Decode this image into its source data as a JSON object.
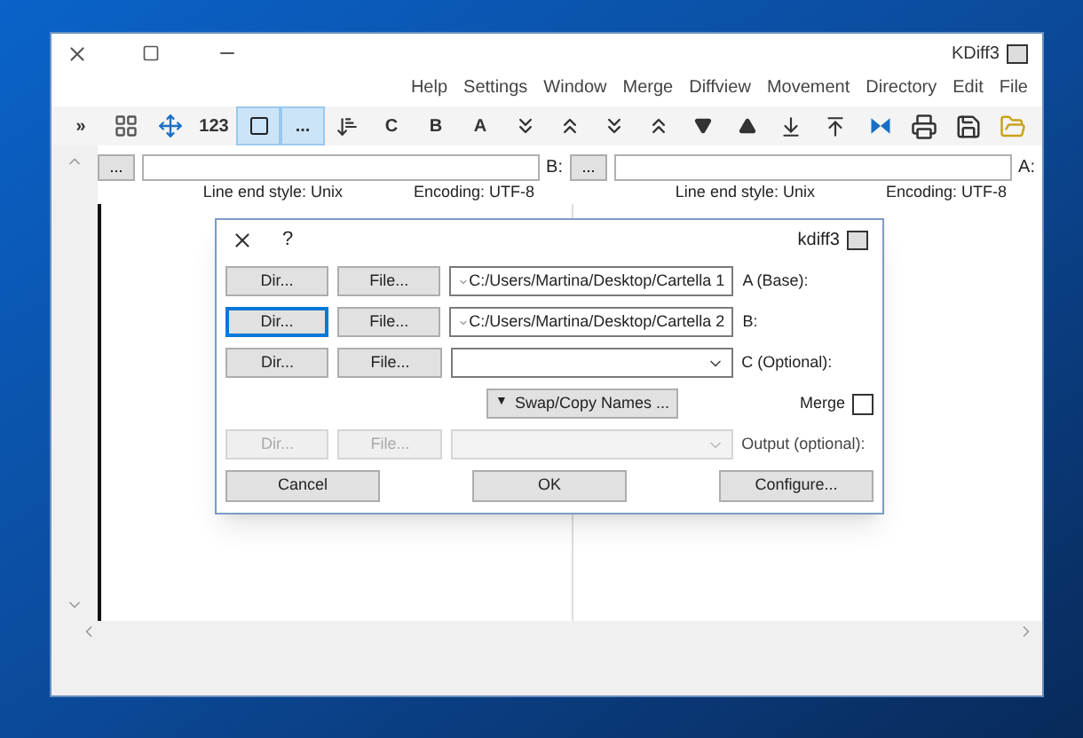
{
  "window": {
    "title": "KDiff3"
  },
  "menu": [
    "Help",
    "Settings",
    "Window",
    "Merge",
    "Diffview",
    "Movement",
    "Directory",
    "Edit",
    "File"
  ],
  "toolbar": [
    {
      "kind": "text",
      "label": "»",
      "selected": false
    },
    {
      "kind": "icon",
      "selected": false
    },
    {
      "kind": "icon",
      "selected": false
    },
    {
      "kind": "text",
      "label": "123",
      "selected": false
    },
    {
      "kind": "icon",
      "selected": true
    },
    {
      "kind": "text",
      "label": "...",
      "selected": true
    },
    {
      "kind": "icon",
      "selected": false
    },
    {
      "kind": "text",
      "label": "C",
      "selected": false
    },
    {
      "kind": "text",
      "label": "B",
      "selected": false
    },
    {
      "kind": "text",
      "label": "A",
      "selected": false
    },
    {
      "kind": "icon",
      "selected": false
    },
    {
      "kind": "icon",
      "selected": false
    },
    {
      "kind": "icon",
      "selected": false
    },
    {
      "kind": "icon",
      "selected": false
    },
    {
      "kind": "icon",
      "selected": false
    },
    {
      "kind": "icon",
      "selected": false
    },
    {
      "kind": "icon",
      "selected": false
    },
    {
      "kind": "icon",
      "selected": false
    },
    {
      "kind": "icon",
      "selected": false
    },
    {
      "kind": "icon",
      "selected": false
    },
    {
      "kind": "icon",
      "selected": false
    },
    {
      "kind": "icon",
      "selected": false
    }
  ],
  "panes": [
    {
      "label": "B:",
      "button": "...",
      "encoding": "Encoding: UTF-8",
      "line_end": "Line end style: Unix"
    },
    {
      "label": "A:",
      "button": "...",
      "encoding": "Encoding: UTF-8",
      "line_end": "Line end style: Unix"
    }
  ],
  "dialog": {
    "title": "kdiff3",
    "help": "?",
    "rows": [
      {
        "kind": "file",
        "label": "A (Base):",
        "value": "C:/Users/Martina/Desktop/Cartella 1",
        "file_button": "File...",
        "dir_button": "Dir...",
        "disabled": false,
        "focused": false
      },
      {
        "kind": "file",
        "label": "B:",
        "value": "C:/Users/Martina/Desktop/Cartella 2",
        "file_button": "File...",
        "dir_button": "Dir...",
        "disabled": false,
        "focused": true
      },
      {
        "kind": "file",
        "label": "C (Optional):",
        "file_button": "File...",
        "dir_button": "Dir...",
        "disabled": false,
        "focused": false
      },
      {
        "kind": "merge",
        "label": "Merge",
        "checked": false,
        "caret": "▼",
        "button": "Swap/Copy Names ..."
      },
      {
        "kind": "file",
        "label": "Output (optional):",
        "file_button": "File...",
        "dir_button": "Dir...",
        "disabled": true,
        "focused": false
      }
    ],
    "buttons": [
      "Cancel",
      "OK",
      "Configure..."
    ]
  }
}
